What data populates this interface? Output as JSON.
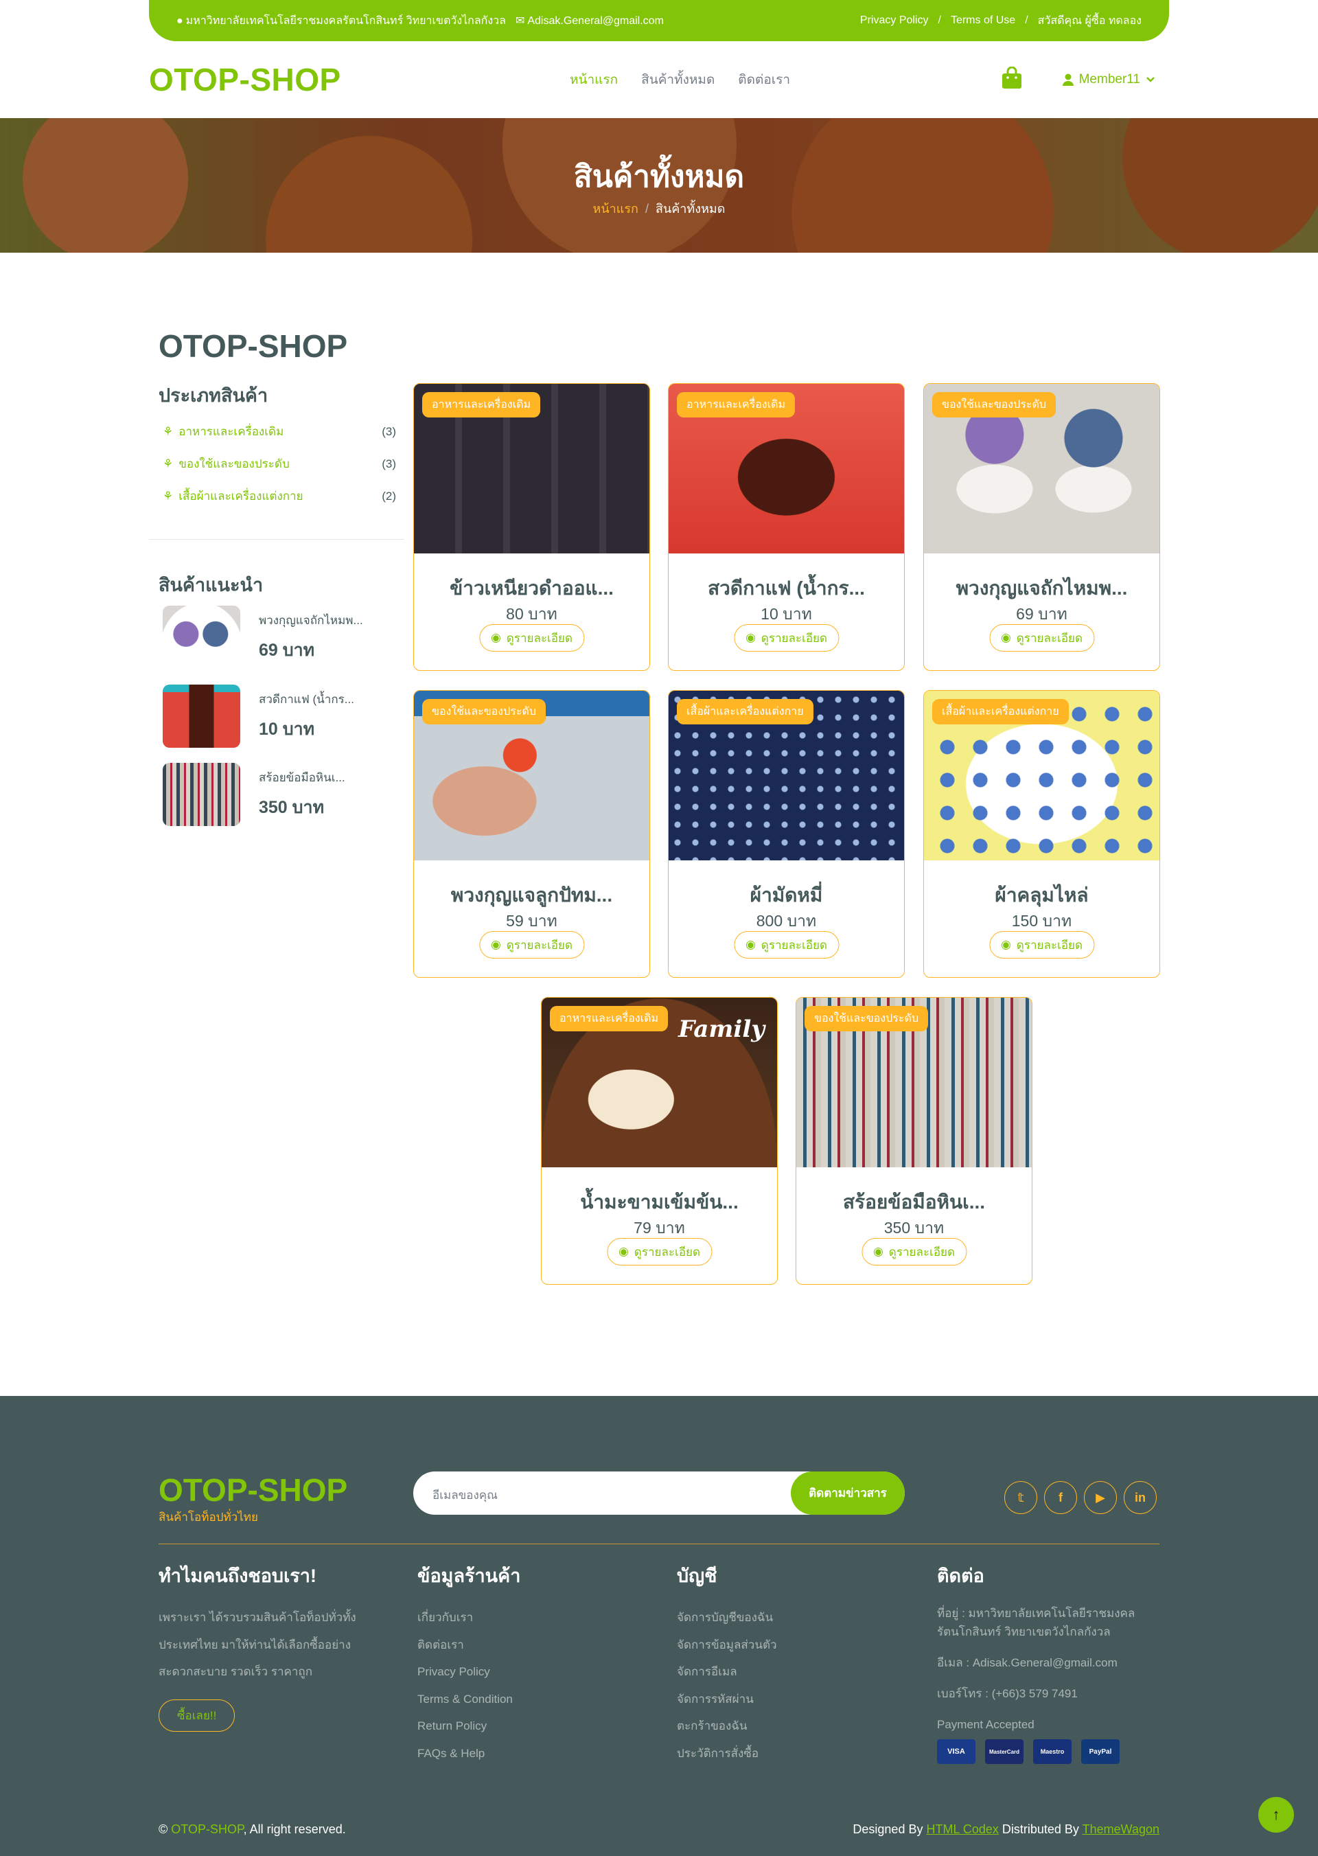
{
  "topbar": {
    "address": "มหาวิทยาลัยเทคโนโลยีราชมงคลรัตนโกสินทร์ วิทยาเขตวังไกลกังวล",
    "email": "Adisak.General@gmail.com",
    "privacy": "Privacy Policy",
    "terms": "Terms of Use",
    "greeting": "สวัสดีคุณ ผู้ซื้อ ทดลอง"
  },
  "header": {
    "brand": "OTOP-SHOP",
    "nav": [
      "หน้าแรก",
      "สินค้าทั้งหมด",
      "ติดต่อเรา"
    ],
    "member": "Member11"
  },
  "hero": {
    "title": "สินค้าทั้งหมด",
    "crumb_home": "หน้าแรก",
    "crumb_current": "สินค้าทั้งหมด"
  },
  "shop": {
    "title": "OTOP-SHOP",
    "categories_heading": "ประเภทสินค้า",
    "categories": [
      {
        "label": "อาหารและเครื่องเดิม",
        "count": "(3)"
      },
      {
        "label": "ของใช้และของประดับ",
        "count": "(3)"
      },
      {
        "label": "เสื้อผ้าและเครื่องแต่งกาย",
        "count": "(2)"
      }
    ],
    "featured_heading": "สินค้าแนะนำ",
    "featured": [
      {
        "name": "พวงกุญแจถักไหมพ...",
        "price": "69 บาท"
      },
      {
        "name": "สวดีกาแฟ (น้ำกร...",
        "price": "10 บาท"
      },
      {
        "name": "สร้อยข้อมือหินเ...",
        "price": "350 บาท"
      }
    ],
    "detail_label": "ดูรายละเอียด",
    "products": [
      {
        "tag": "อาหารและเครื่องเดิม",
        "name": "ข้าวเหนียวดำออแ...",
        "price": "80 บาท"
      },
      {
        "tag": "อาหารและเครื่องเดิม",
        "name": "สวดีกาแฟ (น้ำกร...",
        "price": "10 บาท"
      },
      {
        "tag": "ของใช้และของประดับ",
        "name": "พวงกุญแจถักไหมพ...",
        "price": "69 บาท"
      },
      {
        "tag": "ของใช้และของประดับ",
        "name": "พวงกุญแจลูกปัทม...",
        "price": "59 บาท"
      },
      {
        "tag": "เสื้อผ้าและเครื่องแต่งกาย",
        "name": "ผ้ามัดหมี่",
        "price": "800 บาท"
      },
      {
        "tag": "เสื้อผ้าและเครื่องแต่งกาย",
        "name": "ผ้าคลุมไหล่",
        "price": "150 บาท"
      },
      {
        "tag": "อาหารและเครื่องเดิม",
        "name": "น้ำมะขามเข้มข้น...",
        "price": "79 บาท"
      },
      {
        "tag": "ของใช้และของประดับ",
        "name": "สร้อยข้อมือหินเ...",
        "price": "350 บาท"
      }
    ],
    "image_text": "Family"
  },
  "footer": {
    "brand": "OTOP-SHOP",
    "tagline": "สินค้าโอท็อปทั่วไทย",
    "email_placeholder": "อีเมลของคุณ",
    "subscribe": "ติดตามข่าวสาร",
    "why_heading": "ทำไมคนถึงชอบเรา!",
    "why_text": [
      "เพราะเรา ได้รวบรวมสินค้าโอท็อปทั่วทั้ง",
      "ประเทศไทย มาให้ท่านได้เลือกซื้ออย่าง",
      "สะดวกสะบาย รวดเร็ว ราคาถูก"
    ],
    "buy_now": "ซื้อเลย!!",
    "shop_heading": "ข้อมูลร้านค้า",
    "shop_links": [
      "เกี่ยวกับเรา",
      "ติดต่อเรา",
      "Privacy Policy",
      "Terms & Condition",
      "Return Policy",
      "FAQs & Help"
    ],
    "account_heading": "บัญชี",
    "account_links": [
      "จัดการบัญชีของฉัน",
      "จัดการข้อมูลส่วนตัว",
      "จัดการอีเมล",
      "จัดการรหัสผ่าน",
      "ตะกร้าของฉัน",
      "ประวัติการสั่งซื้อ"
    ],
    "contact_heading": "ติดต่อ",
    "address": "ที่อยู่ : มหาวิทยาลัยเทคโนโลยีราชมงคลรัตนโกสินทร์ วิทยาเขตวังไกลกังวล",
    "email": "อีเมล : Adisak.General@gmail.com",
    "phone": "เบอร์โทร : (+66)3 579 7491",
    "payment": "Payment Accepted",
    "payments": [
      "VISA",
      "MasterCard",
      "Maestro",
      "PayPal"
    ],
    "copyright_brand": "OTOP-SHOP",
    "copyright_rest": ", All right reserved.",
    "designed_by": "Designed By",
    "designer": "HTML Codex",
    "distributed_by": "Distributed By",
    "distributor": "ThemeWagon"
  },
  "colors": {
    "primary": "#81c408",
    "secondary": "#ffb524",
    "dark": "#45595b"
  }
}
